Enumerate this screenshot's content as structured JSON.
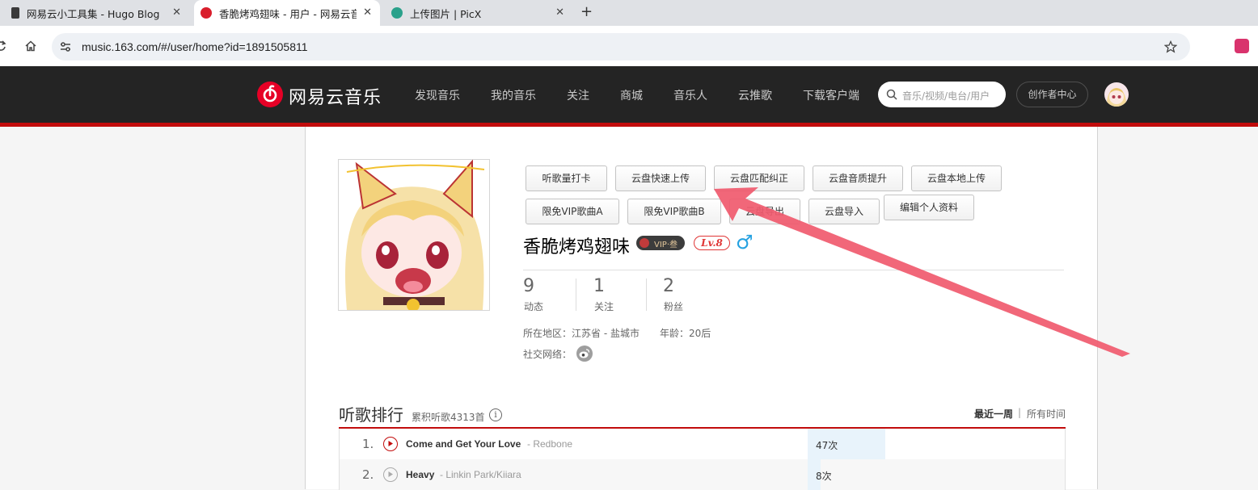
{
  "browser": {
    "tabs": [
      {
        "title": "网易云小工具集 - Hugo Blog",
        "active": false
      },
      {
        "title": "香脆烤鸡翅味 - 用户 - 网易云音",
        "active": true
      },
      {
        "title": "上传图片 | PicX",
        "active": false
      }
    ],
    "close_glyph": "✕",
    "new_tab_glyph": "+",
    "url": "music.163.com/#/user/home?id=1891505811"
  },
  "site": {
    "logo_text": "网易云音乐",
    "nav": [
      "发现音乐",
      "我的音乐",
      "关注",
      "商城",
      "音乐人",
      "云推歌",
      "下载客户端"
    ],
    "search_placeholder": "音乐/视频/电台/用户",
    "creator_center": "创作者中心",
    "brand_color": "#c20c0c"
  },
  "profile": {
    "action_buttons_row1": [
      "听歌量打卡",
      "云盘快速上传",
      "云盘匹配纠正",
      "云盘音质提升",
      "云盘本地上传"
    ],
    "action_buttons_row2": [
      "限免VIP歌曲A",
      "限免VIP歌曲B",
      "云盘导出",
      "云盘导入"
    ],
    "edit_profile": "编辑个人资料",
    "username": "香脆烤鸡翅味",
    "vip_badge": "VIP·叁",
    "level": "Lv.8",
    "gender_symbol": "♂",
    "stats": [
      {
        "value": "9",
        "label": "动态"
      },
      {
        "value": "1",
        "label": "关注"
      },
      {
        "value": "2",
        "label": "粉丝"
      }
    ],
    "region": "所在地区：江苏省 - 盐城市",
    "age": "年龄：20后",
    "social_label": "社交网络："
  },
  "ranking": {
    "title": "听歌排行",
    "subtitle": "累积听歌4313首",
    "info_glyph": "i",
    "tab_week": "最近一周",
    "tab_separator": "|",
    "tab_all": "所有时间",
    "rows": [
      {
        "rank": "1.",
        "song": "Come and Get Your Love",
        "artist": "- Redbone",
        "count": "47次",
        "bar_fraction": 0.3
      },
      {
        "rank": "2.",
        "song": "Heavy",
        "artist": "- Linkin Park/Kiiara",
        "count": "8次",
        "bar_fraction": 0.05
      }
    ]
  }
}
